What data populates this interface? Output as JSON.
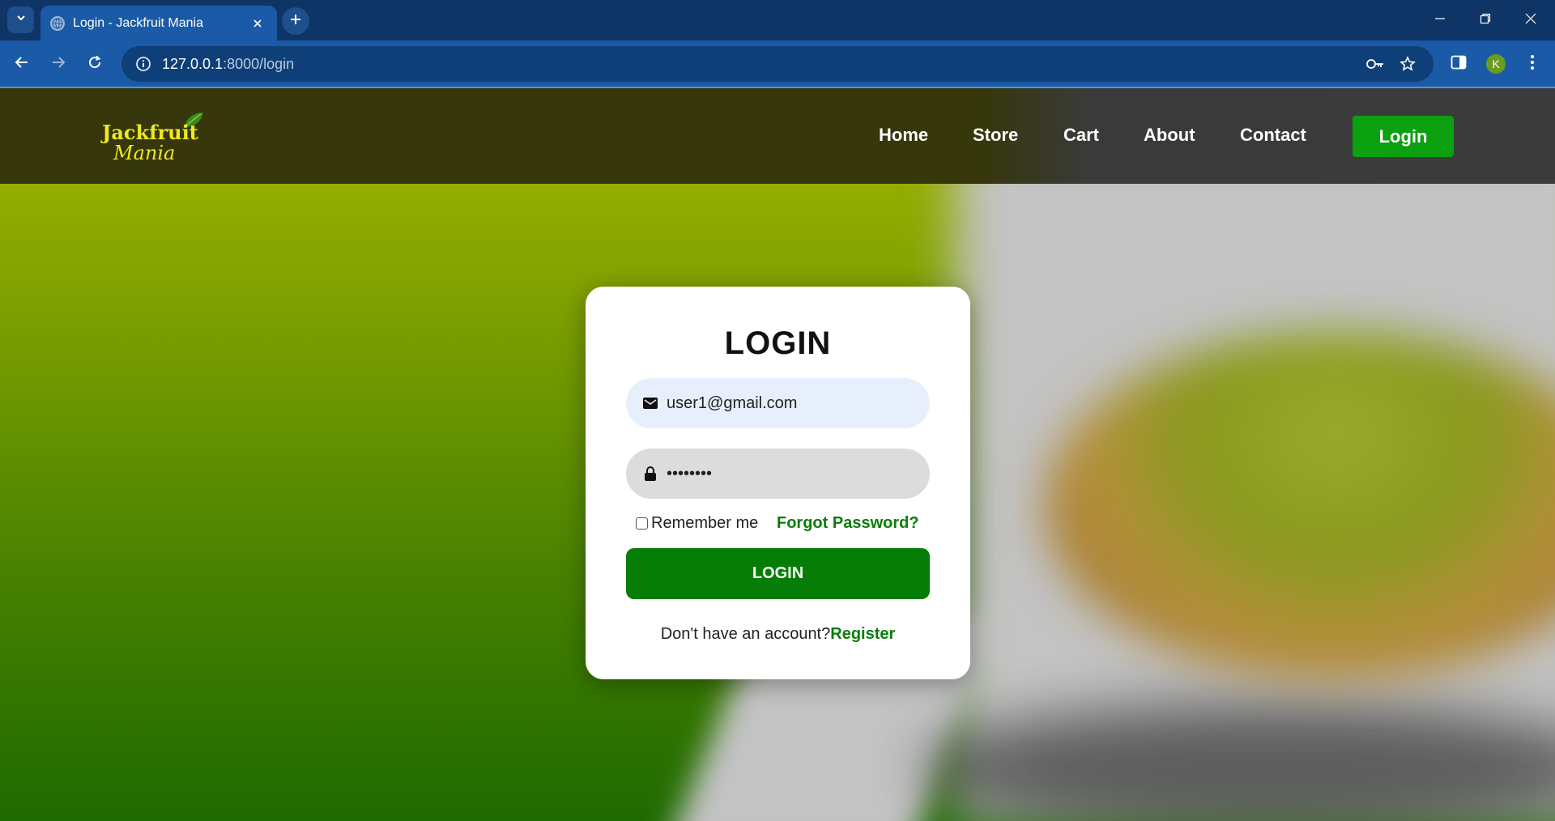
{
  "browser": {
    "tab_title": "Login - Jackfruit Mania",
    "url_host": "127.0.0.1",
    "url_path": ":8000/login",
    "profile_initial": "K"
  },
  "site": {
    "logo_line1": "Jackfruit",
    "logo_line2": "Mania",
    "nav": {
      "home": "Home",
      "store": "Store",
      "cart": "Cart",
      "about": "About",
      "contact": "Contact",
      "login": "Login"
    }
  },
  "login_form": {
    "title": "LOGIN",
    "email_value": "user1@gmail.com",
    "password_value": "••••••••",
    "remember_label": "Remember me",
    "forgot_label": "Forgot Password?",
    "submit_label": "LOGIN",
    "no_account_text": "Don't have an account?",
    "register_label": "Register"
  },
  "colors": {
    "brand_green": "#067d07",
    "nav_login_green": "#0aa010",
    "logo_yellow": "#f0e820",
    "chrome_blue": "#1b5aa6"
  }
}
